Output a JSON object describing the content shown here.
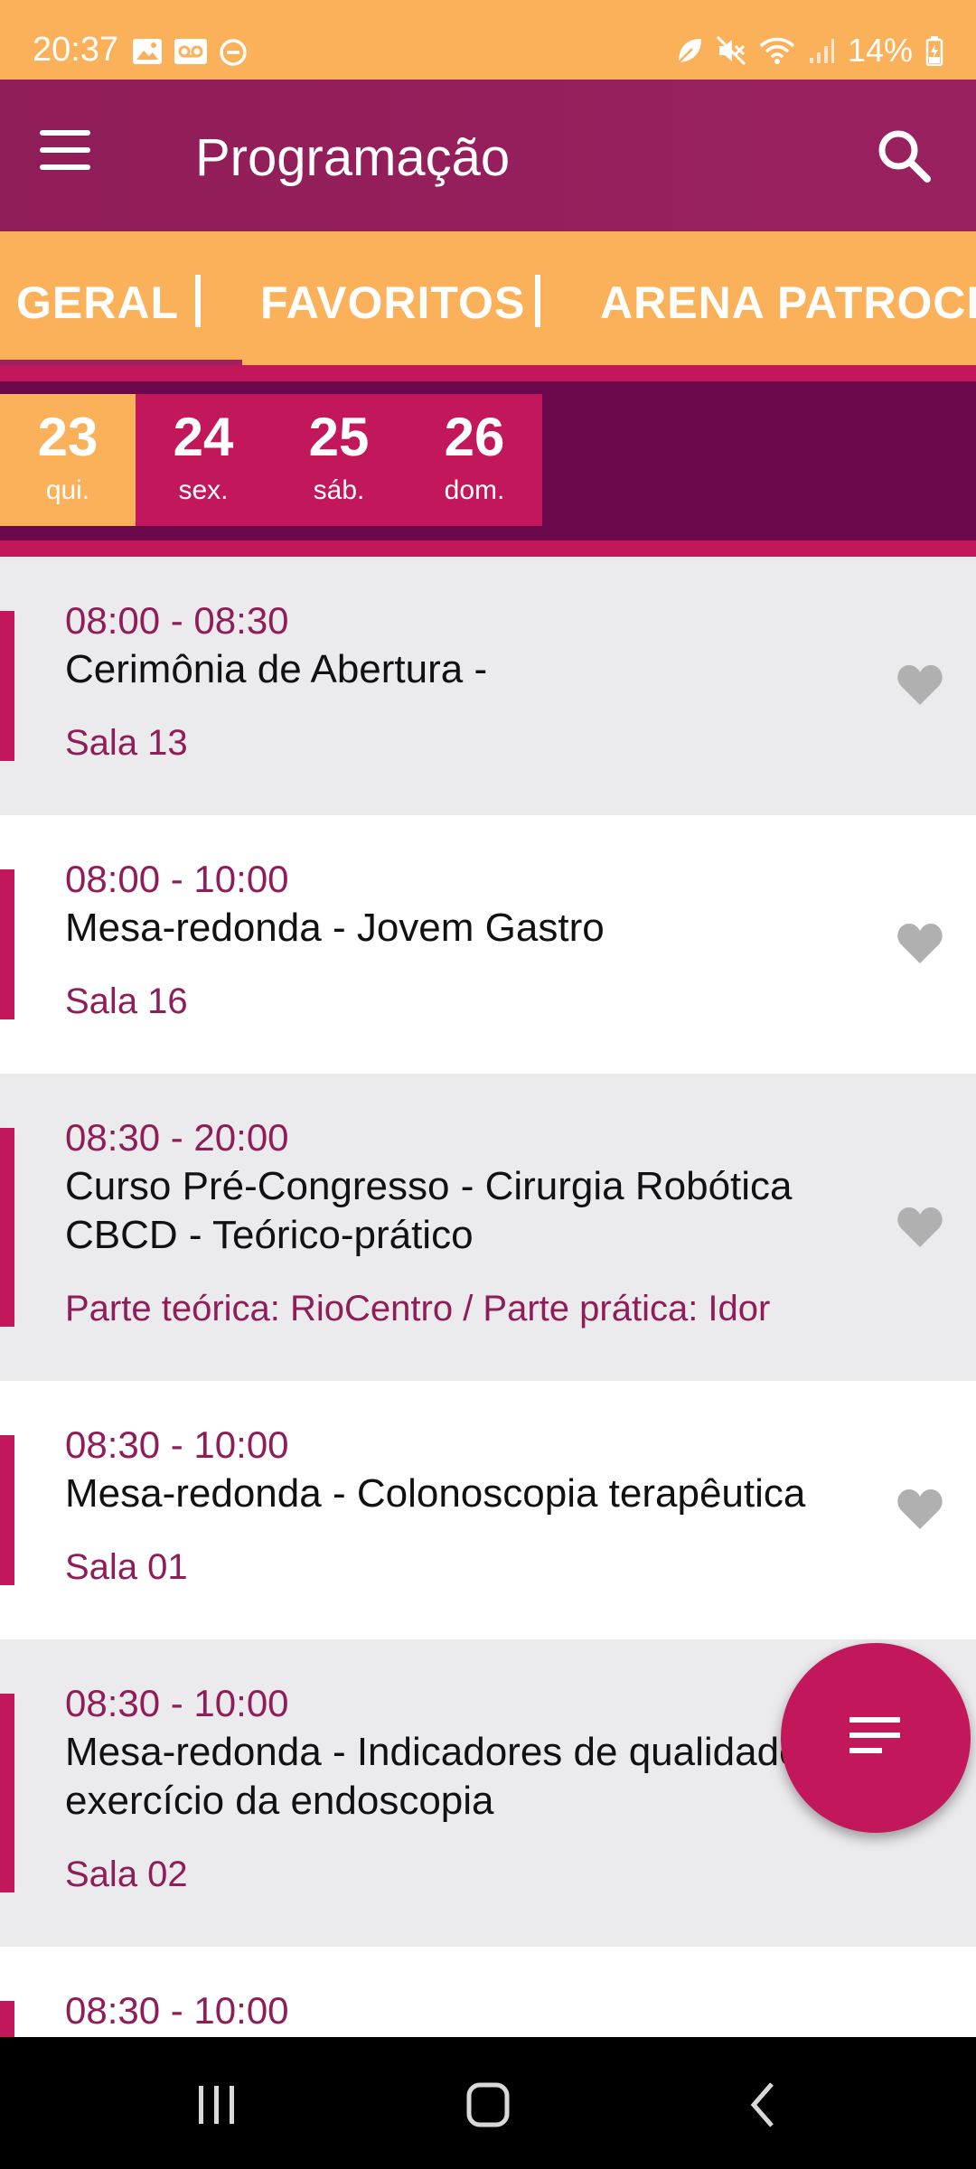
{
  "status_bar": {
    "time": "20:37",
    "battery": "14%",
    "left_icons": [
      "image-icon",
      "voicemail-icon",
      "do-not-disturb-icon"
    ],
    "right_icons": [
      "leaf-icon",
      "mute-icon",
      "wifi-icon",
      "signal-icon",
      "battery-icon"
    ]
  },
  "app_bar": {
    "title": "Programação",
    "menu_icon": "menu-icon",
    "search_icon": "search-icon"
  },
  "tabs": [
    {
      "label": "GERAL",
      "selected": true
    },
    {
      "label": "FAVORITOS",
      "selected": false
    },
    {
      "label": "ARENA PATROCINA",
      "selected": false
    }
  ],
  "dates": [
    {
      "day": "23",
      "weekday": "qui.",
      "selected": true
    },
    {
      "day": "24",
      "weekday": "sex.",
      "selected": false
    },
    {
      "day": "25",
      "weekday": "sáb.",
      "selected": false
    },
    {
      "day": "26",
      "weekday": "dom.",
      "selected": false
    }
  ],
  "events": [
    {
      "time": "08:00 - 08:30",
      "title": "Cerimônia de Abertura -",
      "location": "Sala 13"
    },
    {
      "time": "08:00 - 10:00",
      "title": "Mesa-redonda - Jovem Gastro",
      "location": "Sala 16"
    },
    {
      "time": "08:30 - 20:00",
      "title": "Curso Pré-Congresso - Cirurgia Robótica CBCD - Teórico-prático",
      "location": "Parte teórica: RioCentro / Parte prática: Idor"
    },
    {
      "time": "08:30 - 10:00",
      "title": "Mesa-redonda - Colonoscopia terapêutica",
      "location": "Sala 01"
    },
    {
      "time": "08:30 - 10:00",
      "title": "Mesa-redonda - Indicadores de qualidade no exercício da endoscopia",
      "location": "Sala 02"
    },
    {
      "time": "08:30 - 10:00",
      "title": "",
      "location": ""
    }
  ],
  "fab": {
    "icon": "filter-list-icon"
  },
  "colors": {
    "status_bar": "#fbb05a",
    "app_bar": "#8f1d57",
    "accent": "#c2185b",
    "date_strip": "#6b0849",
    "selected_date": "#fbb05a"
  }
}
